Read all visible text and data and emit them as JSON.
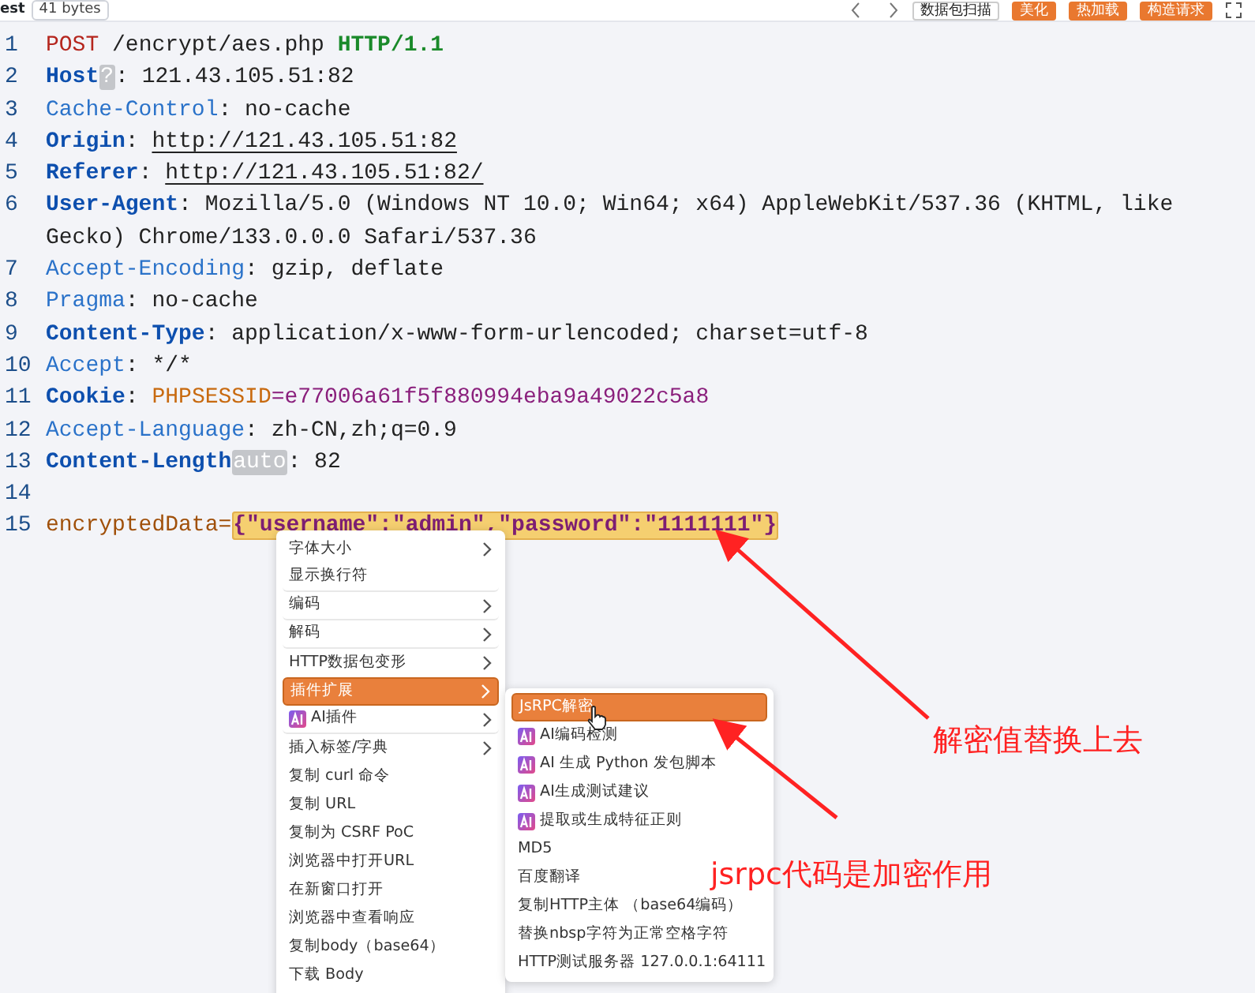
{
  "toolbar": {
    "tab_fragment": "est",
    "size_badge": "41 bytes",
    "buttons": [
      {
        "label": "数据包扫描",
        "kind": "plain"
      },
      {
        "label": "美化",
        "kind": "accent"
      },
      {
        "label": "热加载",
        "kind": "accent"
      },
      {
        "label": "构造请求",
        "kind": "accent"
      }
    ]
  },
  "editor": {
    "lines": [
      {
        "number": "1",
        "tokens": [
          {
            "kind": "method",
            "text": "POST"
          },
          {
            "kind": "plain",
            "text": " /encrypt/aes.php "
          },
          {
            "kind": "proto",
            "text": "HTTP/1.1"
          }
        ]
      },
      {
        "number": "2",
        "tokens": [
          {
            "kind": "header-bold",
            "text": "Host"
          },
          {
            "kind": "hint",
            "text": "?"
          },
          {
            "kind": "plain",
            "text": ": 121.43.105.51:82"
          }
        ]
      },
      {
        "number": "3",
        "tokens": [
          {
            "kind": "header",
            "text": "Cache-Control"
          },
          {
            "kind": "plain",
            "text": ": no-cache"
          }
        ]
      },
      {
        "number": "4",
        "tokens": [
          {
            "kind": "header-bold",
            "text": "Origin"
          },
          {
            "kind": "plain",
            "text": ": "
          },
          {
            "kind": "link",
            "text": "http://121.43.105.51:82"
          }
        ]
      },
      {
        "number": "5",
        "tokens": [
          {
            "kind": "header-bold",
            "text": "Referer"
          },
          {
            "kind": "plain",
            "text": ": "
          },
          {
            "kind": "link",
            "text": "http://121.43.105.51:82/"
          }
        ]
      },
      {
        "number": "6",
        "tokens": [
          {
            "kind": "header-bold",
            "text": "User-Agent"
          },
          {
            "kind": "plain",
            "text": ": Mozilla/5.0 (Windows NT 10.0; Win64; x64) AppleWebKit/537.36 (KHTML, like Gecko) Chrome/133.0.0.0 Safari/537.36"
          }
        ]
      },
      {
        "number": "7",
        "tokens": [
          {
            "kind": "header",
            "text": "Accept-Encoding"
          },
          {
            "kind": "plain",
            "text": ": gzip, deflate"
          }
        ]
      },
      {
        "number": "8",
        "tokens": [
          {
            "kind": "header",
            "text": "Pragma"
          },
          {
            "kind": "plain",
            "text": ": no-cache"
          }
        ]
      },
      {
        "number": "9",
        "tokens": [
          {
            "kind": "header-bold",
            "text": "Content-Type"
          },
          {
            "kind": "plain",
            "text": ": application/x-www-form-urlencoded; charset=utf-8"
          }
        ]
      },
      {
        "number": "10",
        "tokens": [
          {
            "kind": "header",
            "text": "Accept"
          },
          {
            "kind": "plain",
            "text": ": */*"
          }
        ]
      },
      {
        "number": "11",
        "tokens": [
          {
            "kind": "header-bold",
            "text": "Cookie"
          },
          {
            "kind": "plain",
            "text": ": "
          },
          {
            "kind": "cookie-name",
            "text": "PHPSESSID"
          },
          {
            "kind": "cookie-value",
            "text": "=e77006a61f5f880994eba9a49022c5a8"
          }
        ]
      },
      {
        "number": "12",
        "tokens": [
          {
            "kind": "header",
            "text": "Accept-Language"
          },
          {
            "kind": "plain",
            "text": ": zh-CN,zh;q=0.9"
          }
        ]
      },
      {
        "number": "13",
        "tokens": [
          {
            "kind": "header-bold",
            "text": "Content-Length"
          },
          {
            "kind": "hint",
            "text": "auto"
          },
          {
            "kind": "plain",
            "text": ": 82"
          }
        ]
      },
      {
        "number": "14"
      },
      {
        "number": "15",
        "tokens": [
          {
            "kind": "body-key",
            "text": "encryptedData="
          },
          {
            "kind": "selected-value",
            "text": "{\"username\":\"admin\",\"password\":\"1111111\"}"
          }
        ]
      }
    ]
  },
  "context_menu": {
    "items": [
      {
        "label": "字体大小",
        "submenu": true,
        "selected": false,
        "separator": false
      },
      {
        "label": "显示换行符",
        "submenu": false,
        "selected": false,
        "separator": true
      },
      {
        "label": "编码",
        "submenu": true,
        "selected": false,
        "separator": true
      },
      {
        "label": "解码",
        "submenu": true,
        "selected": false,
        "separator": true
      },
      {
        "label": "HTTP数据包变形",
        "submenu": true,
        "selected": false,
        "separator": false
      },
      {
        "label": "插件扩展",
        "submenu": true,
        "selected": true,
        "separator": false
      },
      {
        "label": "AI插件",
        "submenu": true,
        "selected": false,
        "separator": true,
        "kind": "ai"
      },
      {
        "label": "插入标签/字典",
        "submenu": true,
        "selected": false,
        "separator": false
      },
      {
        "label": "复制 curl 命令",
        "submenu": false,
        "selected": false,
        "separator": false
      },
      {
        "label": "复制 URL",
        "submenu": false,
        "selected": false,
        "separator": false
      },
      {
        "label": "复制为 CSRF PoC",
        "submenu": false,
        "selected": false,
        "separator": false
      },
      {
        "label": "浏览器中打开URL",
        "submenu": false,
        "selected": false,
        "separator": false
      },
      {
        "label": "在新窗口打开",
        "submenu": false,
        "selected": false,
        "separator": false
      },
      {
        "label": "浏览器中查看响应",
        "submenu": false,
        "selected": false,
        "separator": false
      },
      {
        "label": "复制body（base64）",
        "submenu": false,
        "selected": false,
        "separator": false
      },
      {
        "label": "下载 Body",
        "submenu": false,
        "selected": false,
        "separator": false
      }
    ]
  },
  "submenu": {
    "items": [
      {
        "label": "JsRPC解密",
        "selected": true,
        "kind": "plain"
      },
      {
        "label": "AI编码检测",
        "selected": false,
        "kind": "ai"
      },
      {
        "label": "AI 生成 Python 发包脚本",
        "selected": false,
        "kind": "ai"
      },
      {
        "label": "AI生成测试建议",
        "selected": false,
        "kind": "ai"
      },
      {
        "label": "提取或生成特征正则",
        "selected": false,
        "kind": "ai"
      },
      {
        "label": "MD5",
        "selected": false,
        "kind": "plain"
      },
      {
        "label": "百度翻译",
        "selected": false,
        "kind": "plain"
      },
      {
        "label": "复制HTTP主体 （base64编码）",
        "selected": false,
        "kind": "plain"
      },
      {
        "label": "替换nbsp字符为正常空格字符",
        "selected": false,
        "kind": "plain"
      },
      {
        "label": "HTTP测试服务器 127.0.0.1:64111",
        "selected": false,
        "kind": "plain"
      }
    ]
  },
  "annotations": [
    "解密值替换上去",
    "jsrpc代码是加密作用"
  ]
}
